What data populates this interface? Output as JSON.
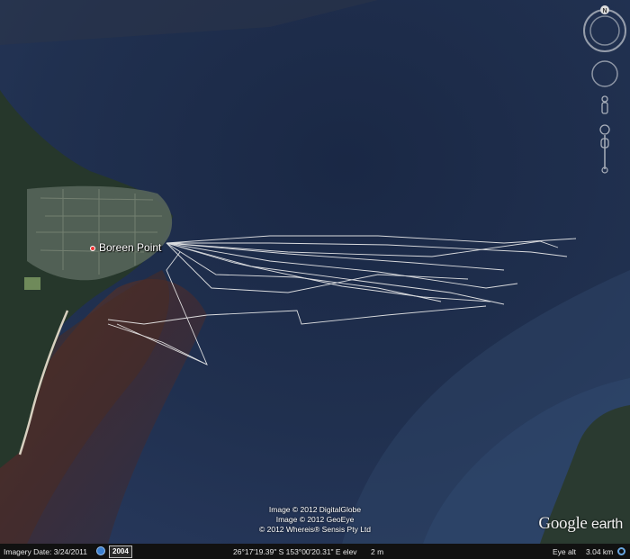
{
  "map": {
    "place_label": "Boreen Point",
    "colors": {
      "water_dark": "#1c2a45",
      "water_mid": "#25365a",
      "shallow_sand": "#4a3028",
      "land_forest": "#27382a",
      "town": "#5c6b5a",
      "track": "#f0f0f0"
    }
  },
  "credits": {
    "line1": "Image © 2012 DigitalGlobe",
    "line2": "Image © 2012 GeoEye",
    "line3": "© 2012 Whereis® Sensis Pty Ltd"
  },
  "logo": {
    "google": "Google",
    "earth": "earth"
  },
  "status": {
    "imagery_date": "Imagery Date: 3/24/2011",
    "year": "2004",
    "coordinates": "26°17'19.39\" S 153°00'20.31\" E elev",
    "elev_value": "2 m",
    "eye_alt_label": "Eye alt",
    "eye_alt_value": "3.04 km"
  },
  "nav": {
    "north_label": "N",
    "icons": [
      "compass-ring-icon",
      "look-joystick-icon",
      "street-view-pegman-icon",
      "zoom-slider-icon"
    ]
  }
}
